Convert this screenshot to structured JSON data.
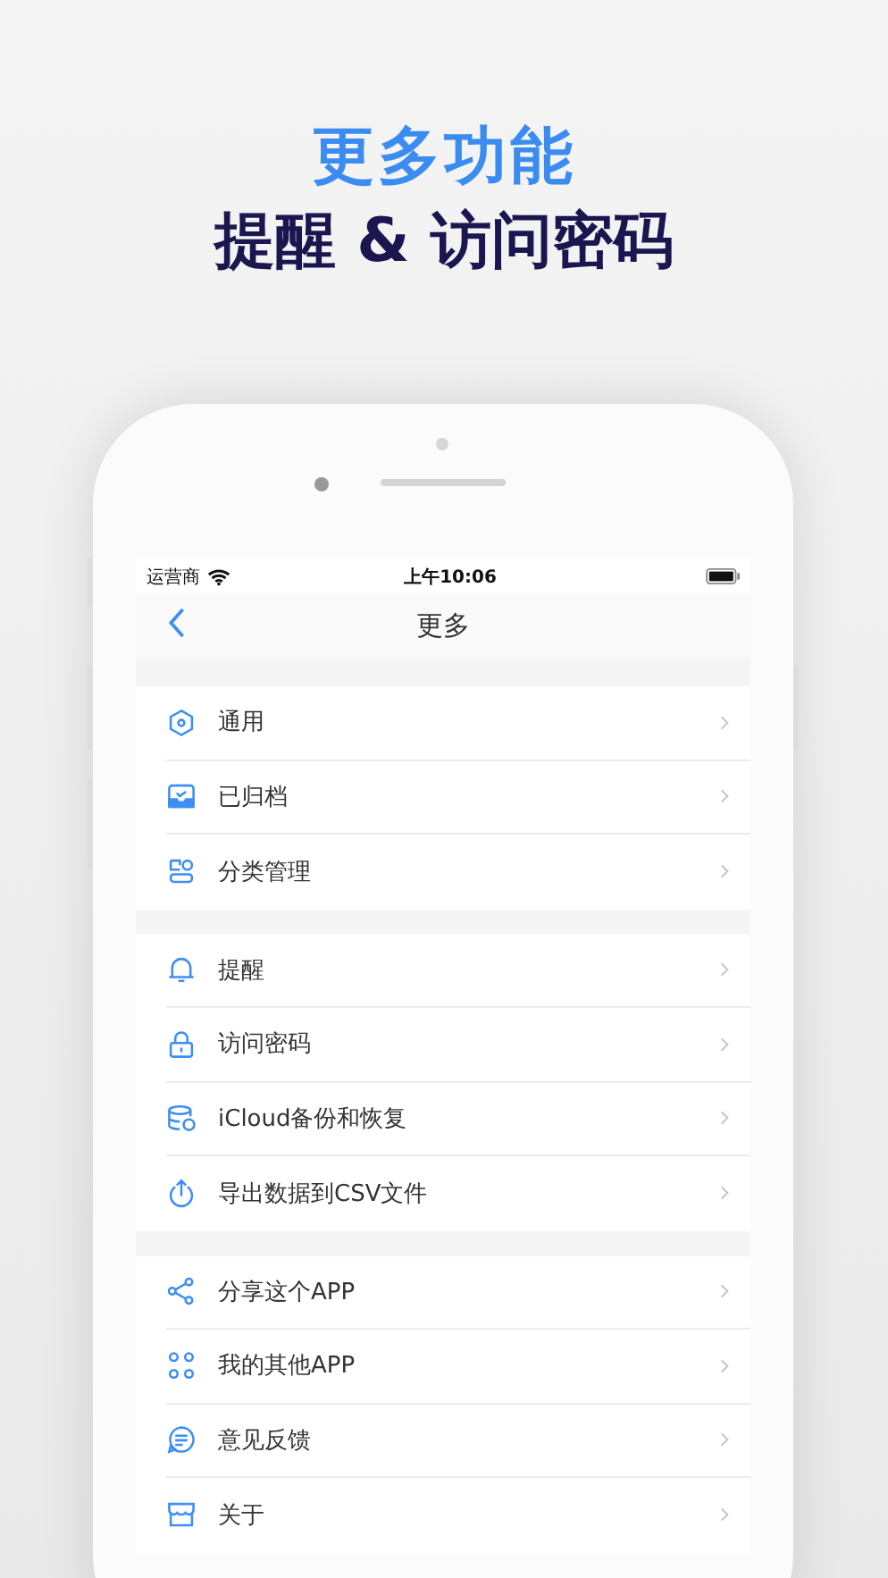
{
  "headline": {
    "title": "更多功能",
    "subtitle": "提醒 & 访问密码"
  },
  "status_bar": {
    "carrier": "运营商",
    "time": "上午10:06"
  },
  "nav_bar": {
    "title": "更多"
  },
  "groups": [
    {
      "items": [
        {
          "label": "通用"
        },
        {
          "label": "已归档"
        },
        {
          "label": "分类管理"
        }
      ]
    },
    {
      "items": [
        {
          "label": "提醒"
        },
        {
          "label": "访问密码"
        },
        {
          "label": "iCloud备份和恢复"
        },
        {
          "label": "导出数据到CSV文件"
        }
      ]
    },
    {
      "items": [
        {
          "label": "分享这个APP"
        },
        {
          "label": "我的其他APP"
        },
        {
          "label": "意见反馈"
        },
        {
          "label": "关于"
        }
      ]
    }
  ]
}
